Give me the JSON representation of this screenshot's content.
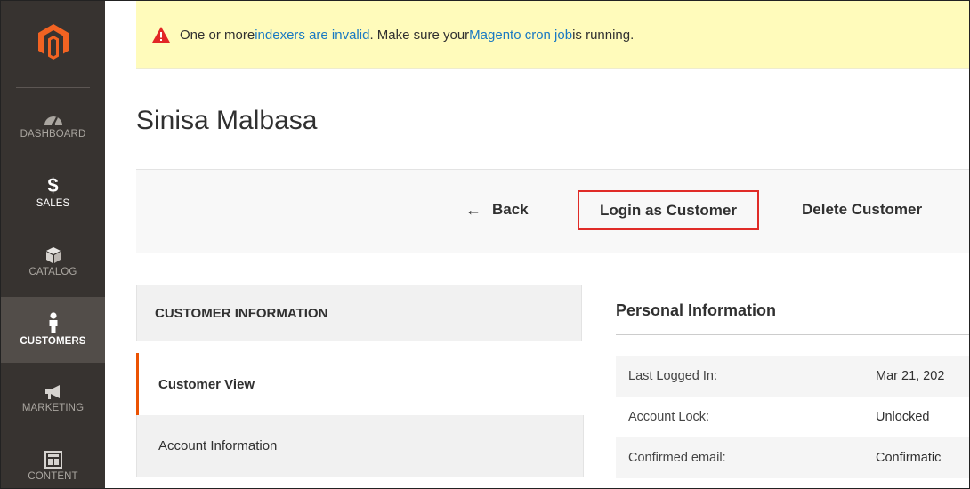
{
  "sidebar": {
    "logo_icon": "magento-logo-icon",
    "items": [
      {
        "label": "Dashboard",
        "icon": "speedometer-icon",
        "active": false
      },
      {
        "label": "Sales",
        "icon": "dollar-icon",
        "active": false
      },
      {
        "label": "Catalog",
        "icon": "cube-icon",
        "active": false
      },
      {
        "label": "Customers",
        "icon": "person-icon",
        "active": true
      },
      {
        "label": "Marketing",
        "icon": "megaphone-icon",
        "active": false
      },
      {
        "label": "Content",
        "icon": "layout-icon",
        "active": false
      }
    ]
  },
  "notice": {
    "icon": "warning-triangle-icon",
    "text_1": "One or more ",
    "link_1": "indexers are invalid",
    "text_2": ". Make sure your ",
    "link_2": "Magento cron job",
    "text_3": " is running."
  },
  "page": {
    "title": "Sinisa Malbasa"
  },
  "actions": {
    "back_arrow": "←",
    "back_label": "Back",
    "login_label": "Login as Customer",
    "delete_label": "Delete Customer"
  },
  "tabs": {
    "heading": "CUSTOMER INFORMATION",
    "items": [
      {
        "label": "Customer View",
        "active": true
      },
      {
        "label": "Account Information",
        "active": false
      }
    ]
  },
  "personal_info": {
    "title": "Personal Information",
    "rows": [
      {
        "label": "Last Logged In:",
        "value": "Mar 21, 202"
      },
      {
        "label": "Account Lock:",
        "value": "Unlocked"
      },
      {
        "label": "Confirmed email:",
        "value": "Confirmatic"
      }
    ]
  },
  "colors": {
    "sidebar_bg": "#373330",
    "sidebar_active_bg": "#524d49",
    "logo_orange": "#f26322",
    "notice_bg": "#fffbbb",
    "link_blue": "#1979c3",
    "highlight_red": "#e02b27",
    "active_tab_accent": "#eb5202",
    "warning_icon": "#e22626"
  }
}
